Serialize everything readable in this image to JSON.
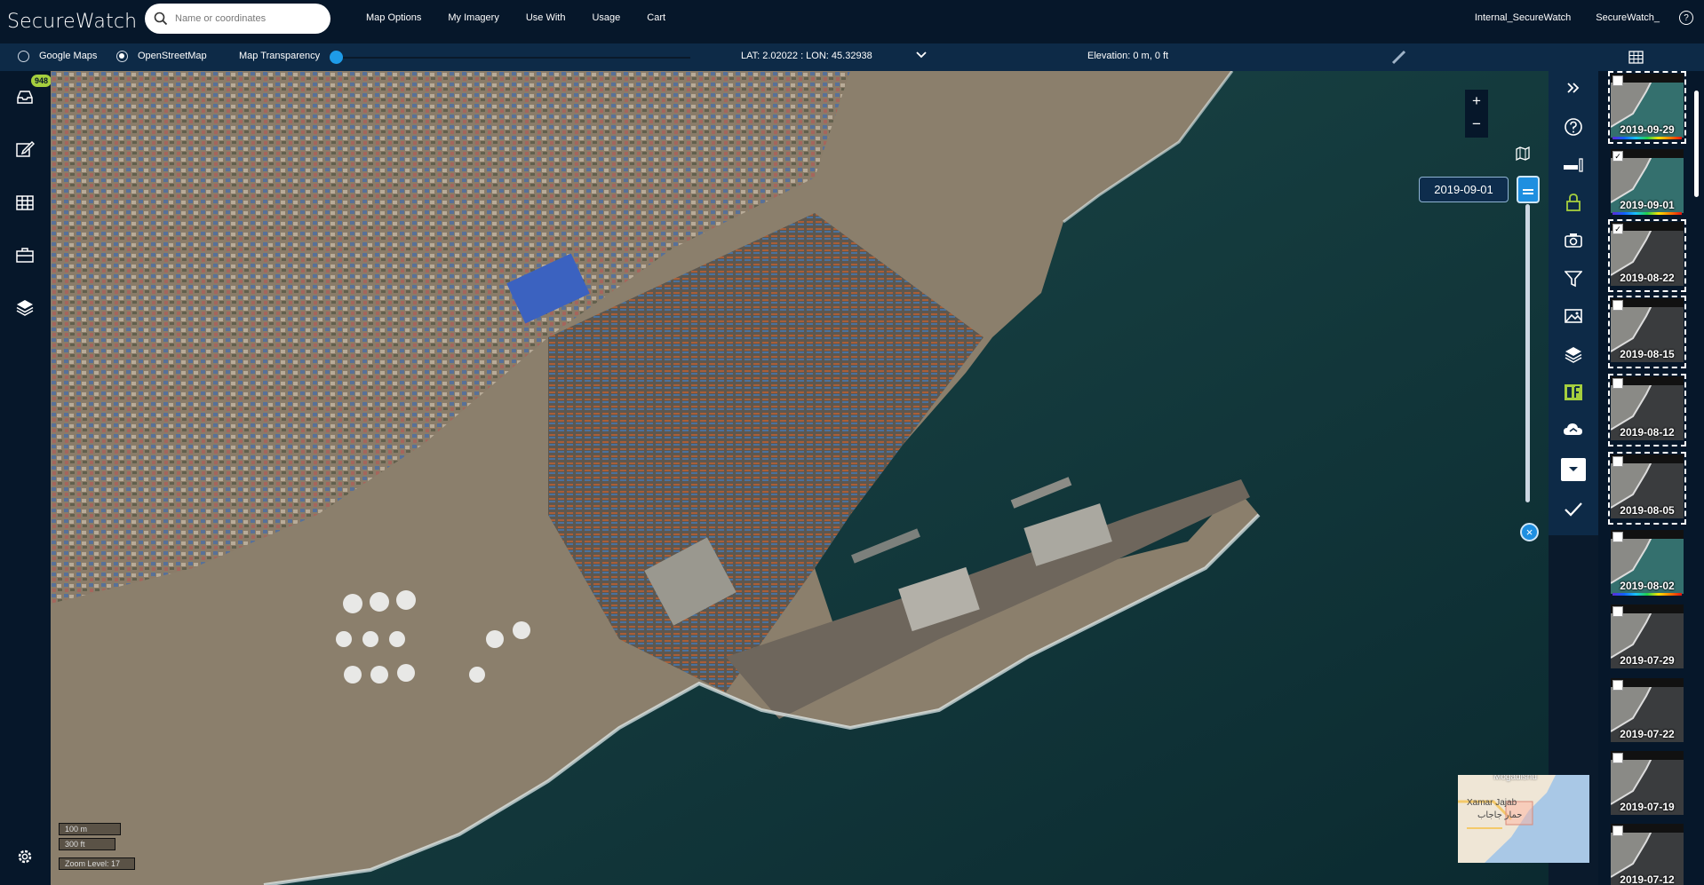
{
  "app": {
    "title": "SecureWatch"
  },
  "search": {
    "placeholder": "Name or coordinates"
  },
  "menu": [
    "Map Options",
    "My Imagery",
    "Use With",
    "Usage",
    "Cart"
  ],
  "user": {
    "org": "Internal_SecureWatch",
    "account": "SecureWatch_"
  },
  "subbar": {
    "basemap_google": "Google Maps",
    "basemap_osm": "OpenStreetMap",
    "selected_basemap": "OpenStreetMap",
    "transparency_label": "Map Transparency",
    "transparency_value": 0,
    "coords": "LAT: 2.02022 : LON: 45.32938",
    "elevation": "Elevation: 0 m, 0 ft"
  },
  "notifications": {
    "count": "948"
  },
  "map": {
    "scale_m": "100 m",
    "scale_ft": "300 ft",
    "zoom_level": "Zoom Level: 17",
    "selected_date": "2019-09-01",
    "minimap_labels": [
      "Mogadishu",
      "Xamar Jajab",
      "حمار جاجاب"
    ]
  },
  "colors": {
    "accent": "#1e8fe0",
    "lock": "#a5cf3e",
    "header": "#06172a",
    "subbar": "#0d2a47"
  },
  "thumbnails": [
    {
      "date": "2019-09-29",
      "checked": false,
      "selected": true,
      "rainbow": true
    },
    {
      "date": "2019-09-01",
      "checked": true,
      "selected": false,
      "rainbow": true
    },
    {
      "date": "2019-08-22",
      "checked": true,
      "selected": true,
      "rainbow": false
    },
    {
      "date": "2019-08-15",
      "checked": false,
      "selected": true,
      "rainbow": false
    },
    {
      "date": "2019-08-12",
      "checked": false,
      "selected": true,
      "rainbow": false
    },
    {
      "date": "2019-08-05",
      "checked": false,
      "selected": true,
      "rainbow": false
    },
    {
      "date": "2019-08-02",
      "checked": false,
      "selected": false,
      "rainbow": true
    },
    {
      "date": "2019-07-29",
      "checked": false,
      "selected": false,
      "rainbow": false
    },
    {
      "date": "2019-07-22",
      "checked": false,
      "selected": false,
      "rainbow": false
    },
    {
      "date": "2019-07-19",
      "checked": false,
      "selected": false,
      "rainbow": false
    },
    {
      "date": "2019-07-12",
      "checked": false,
      "selected": false,
      "rainbow": false
    }
  ]
}
